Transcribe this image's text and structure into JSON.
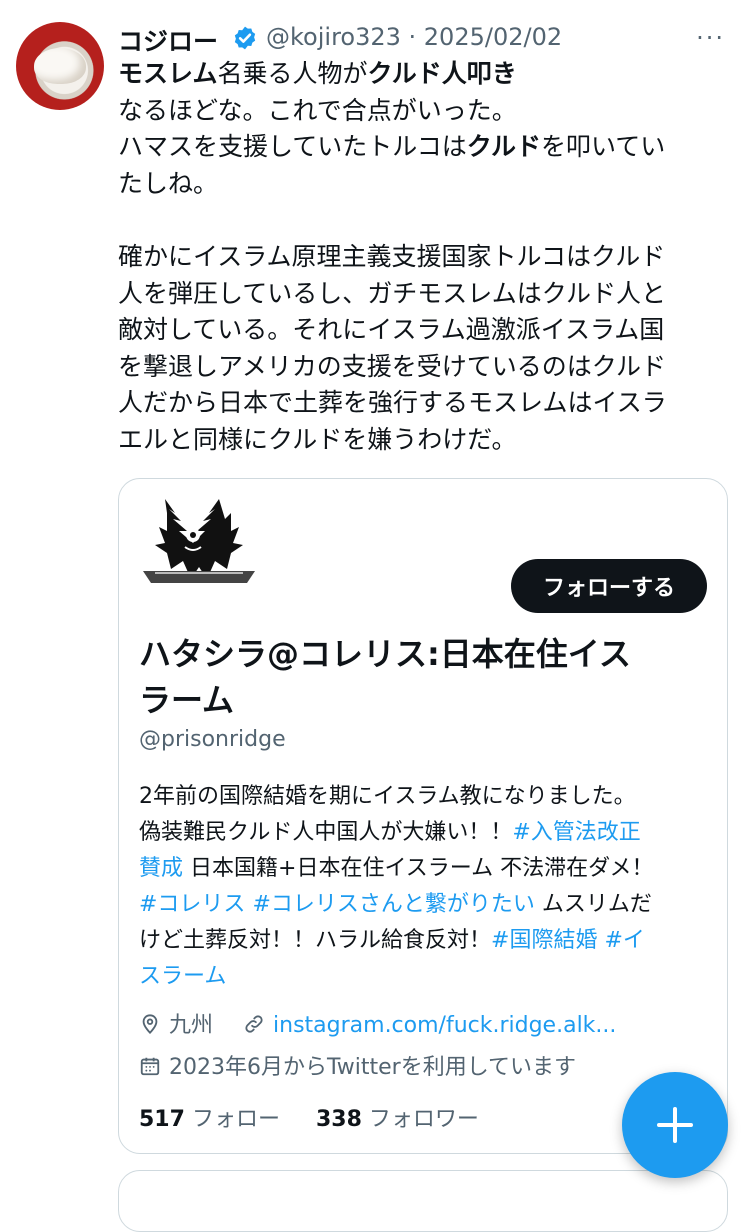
{
  "tweet": {
    "author_name": "コジロー",
    "handle_date": "@kojiro323 · 2025/02/02",
    "more_label": "···",
    "lines": [
      [
        {
          "t": "モスレム",
          "b": true
        },
        {
          "t": "名乗る人物が",
          "b": false
        },
        {
          "t": "クルド人叩き",
          "b": true
        }
      ],
      [
        {
          "t": "なるほどな。これで合点がいった。",
          "b": false
        }
      ],
      [
        {
          "t": "ハマスを支援していたトルコは",
          "b": false
        },
        {
          "t": "クルド",
          "b": true
        },
        {
          "t": "を叩いてい",
          "b": false
        }
      ],
      [
        {
          "t": "たしね。",
          "b": false
        }
      ],
      [],
      [
        {
          "t": "確かにイスラム原理主義支援国家トルコはクルド",
          "b": false
        }
      ],
      [
        {
          "t": "人を弾圧しているし、ガチモスレムはクルド人と",
          "b": false
        }
      ],
      [
        {
          "t": "敵対している。それにイスラム過激派イスラム国",
          "b": false
        }
      ],
      [
        {
          "t": "を撃退しアメリカの支援を受けているのはクルド",
          "b": false
        }
      ],
      [
        {
          "t": "人だから日本で土葬を強行するモスレムはイスラ",
          "b": false
        }
      ],
      [
        {
          "t": "エルと同様にクルドを嫌うわけだ。",
          "b": false
        }
      ]
    ]
  },
  "profile_card": {
    "follow_label": "フォローする",
    "name_line1": "ハタシラ@コレリス:日本在住イス",
    "name_line2": "ラーム",
    "handle": "@prisonridge",
    "bio_lines": [
      [
        {
          "t": "2年前の国際結婚を期にイスラム教になりました。",
          "h": false
        }
      ],
      [
        {
          "t": "偽装難民クルド人中国人が大嫌い！！",
          "h": false
        },
        {
          "t": "#入管法改正",
          "h": true
        }
      ],
      [
        {
          "t": "賛成",
          "h": true
        },
        {
          "t": " 日本国籍+日本在住イスラーム 不法滞在ダメ！",
          "h": false
        }
      ],
      [
        {
          "t": "#コレリス",
          "h": true
        },
        {
          "t": " ",
          "h": false
        },
        {
          "t": "#コレリスさんと繋がりたい",
          "h": true
        },
        {
          "t": " ムスリムだ",
          "h": false
        }
      ],
      [
        {
          "t": "けど土葬反対！！ハラル給食反対！",
          "h": false
        },
        {
          "t": "#国際結婚",
          "h": true
        },
        {
          "t": " ",
          "h": false
        },
        {
          "t": "#イ",
          "h": true
        }
      ],
      [
        {
          "t": "スラーム",
          "h": true
        }
      ]
    ],
    "location": "九州",
    "website": "instagram.com/fuck.ridge.alk...",
    "joined": "2023年6月からTwitterを利用しています",
    "following_count": "517",
    "following_label": "フォロー",
    "followers_count": "338",
    "followers_label": "フォロワー"
  },
  "fab": {
    "icon": "plus-icon"
  },
  "colors": {
    "accent": "#1d9bf0",
    "text": "#0f1419",
    "muted": "#536471",
    "border": "#cfd9de"
  }
}
